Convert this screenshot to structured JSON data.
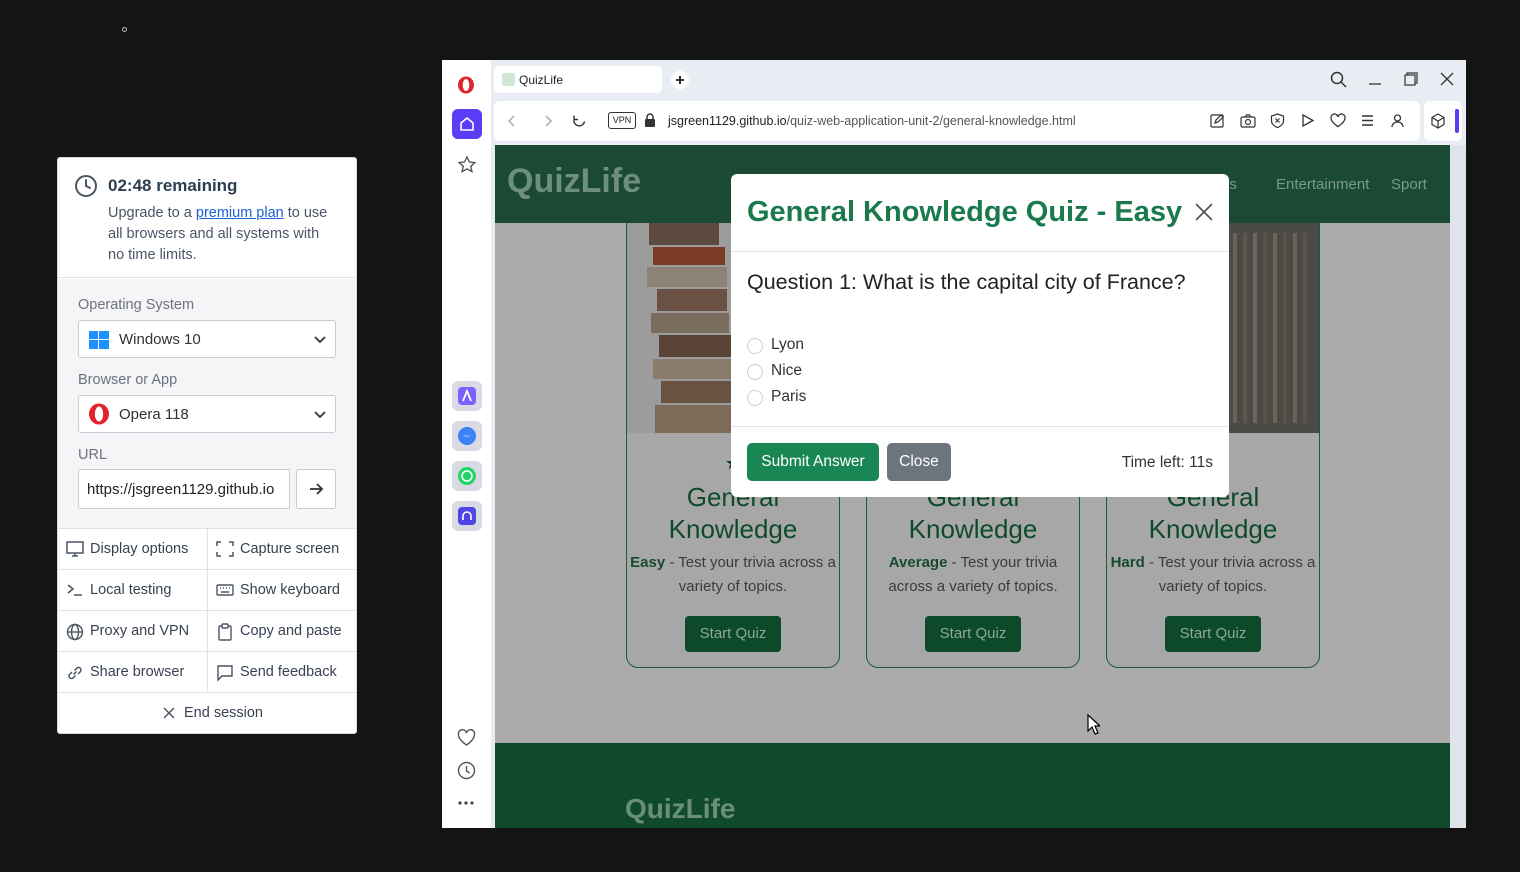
{
  "panel": {
    "timer": "02:48 remaining",
    "upgrade_prefix": "Upgrade to a ",
    "upgrade_link": "premium plan",
    "upgrade_suffix": " to use all browsers and all systems with no time limits.",
    "os_label": "Operating System",
    "os_value": "Windows 10",
    "browser_label": "Browser or App",
    "browser_value": "Opera 118",
    "url_label": "URL",
    "url_value": "https://jsgreen1129.github.io",
    "options": [
      {
        "label": "Display options",
        "icon": "monitor-icon"
      },
      {
        "label": "Capture screen",
        "icon": "capture-icon"
      },
      {
        "label": "Local testing",
        "icon": "terminal-icon"
      },
      {
        "label": "Show keyboard",
        "icon": "keyboard-icon"
      },
      {
        "label": "Proxy and VPN",
        "icon": "globe-icon"
      },
      {
        "label": "Copy and paste",
        "icon": "clipboard-icon"
      },
      {
        "label": "Share browser",
        "icon": "link-icon"
      },
      {
        "label": "Send feedback",
        "icon": "message-icon"
      }
    ],
    "end_session": "End session"
  },
  "browser": {
    "tab_title": "QuizLife",
    "vpn_badge": "VPN",
    "url_domain": "jsgreen1129.github.io",
    "url_path": "/quiz-web-application-unit-2/general-knowledge.html"
  },
  "page": {
    "brand": "QuizLife",
    "nav": [
      "atics",
      "Entertainment",
      "Sport"
    ],
    "cards": [
      {
        "title": "General Knowledge",
        "level": "Easy",
        "desc": " - Test your trivia across a variety of topics.",
        "button": "Start Quiz"
      },
      {
        "title": "General Knowledge",
        "level": "Average",
        "desc": " - Test your trivia across a variety of topics.",
        "button": "Start Quiz"
      },
      {
        "title": "General Knowledge",
        "level": "Hard",
        "desc": " - Test your trivia across a variety of topics.",
        "button": "Start Quiz"
      }
    ],
    "footer_brand": "QuizLife"
  },
  "modal": {
    "title": "General Knowledge Quiz - Easy",
    "question": "Question 1: What is the capital city of France?",
    "options": [
      "Lyon",
      "Nice",
      "Paris"
    ],
    "submit": "Submit Answer",
    "close": "Close",
    "time_left": "Time left: 11s"
  },
  "colors": {
    "brand_green": "#198754",
    "dark_green": "#1a4a33",
    "link_blue": "#1a5fd6",
    "opera_red": "#e0232d",
    "sidebar_active": "#5b3df5"
  }
}
